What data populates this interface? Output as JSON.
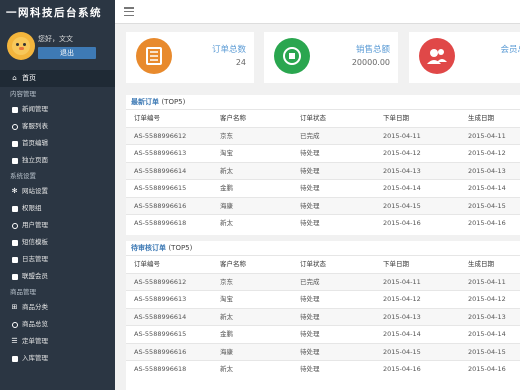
{
  "sidebar": {
    "title": "一网科技后台系统",
    "user": {
      "greeting": "您好，文文",
      "logout": "退出"
    },
    "home": "首页",
    "sections": [
      {
        "title": "内容管理",
        "items": [
          "新闻管理",
          "客服列表",
          "首页编辑",
          "独立页面"
        ]
      },
      {
        "title": "系统设置",
        "items": [
          "网站设置",
          "权限组",
          "用户管理",
          "短信模板",
          "日志管理",
          "联盟会员"
        ]
      },
      {
        "title": "商品管理",
        "items": [
          "商品分类",
          "商品总览",
          "定单管理",
          "入库管理"
        ]
      }
    ]
  },
  "stats": [
    {
      "label": "订单总数",
      "value": "24",
      "color": "#e88a2d",
      "icon": "list-icon"
    },
    {
      "label": "销售总额",
      "value": "20000.00",
      "color": "#2aa64f",
      "icon": "money-icon"
    },
    {
      "label": "会员总",
      "value": "",
      "color": "#e04848",
      "icon": "users-icon"
    }
  ],
  "latest_orders": {
    "title": "最新订单",
    "subtitle": "(TOP5)",
    "columns": [
      "订单编号",
      "客户名称",
      "订单状态",
      "下单日期",
      "生成日期"
    ],
    "rows": [
      [
        "AS-5588996612",
        "京东",
        "已完成",
        "2015-04-11",
        "2015-04-11"
      ],
      [
        "AS-5588996613",
        "淘宝",
        "待处理",
        "2015-04-12",
        "2015-04-12"
      ],
      [
        "AS-5588996614",
        "新太",
        "待处理",
        "2015-04-13",
        "2015-04-13"
      ],
      [
        "AS-5588996615",
        "金鹏",
        "待处理",
        "2015-04-14",
        "2015-04-14"
      ],
      [
        "AS-5588996616",
        "海康",
        "待处理",
        "2015-04-15",
        "2015-04-15"
      ],
      [
        "AS-5588996618",
        "新太",
        "待处理",
        "2015-04-16",
        "2015-04-16"
      ]
    ]
  },
  "pending_orders": {
    "title": "待审核订单",
    "subtitle": "(TOP5)",
    "columns": [
      "订单编号",
      "客户名称",
      "订单状态",
      "下单日期",
      "生成日期"
    ],
    "rows": [
      [
        "AS-5588996612",
        "京东",
        "已完成",
        "2015-04-11",
        "2015-04-11"
      ],
      [
        "AS-5588996613",
        "淘宝",
        "待处理",
        "2015-04-12",
        "2015-04-12"
      ],
      [
        "AS-5588996614",
        "新太",
        "待处理",
        "2015-04-13",
        "2015-04-13"
      ],
      [
        "AS-5588996615",
        "金鹏",
        "待处理",
        "2015-04-14",
        "2015-04-14"
      ],
      [
        "AS-5588996616",
        "海康",
        "待处理",
        "2015-04-15",
        "2015-04-15"
      ],
      [
        "AS-5588996618",
        "新太",
        "待处理",
        "2015-04-16",
        "2015-04-16"
      ]
    ]
  }
}
